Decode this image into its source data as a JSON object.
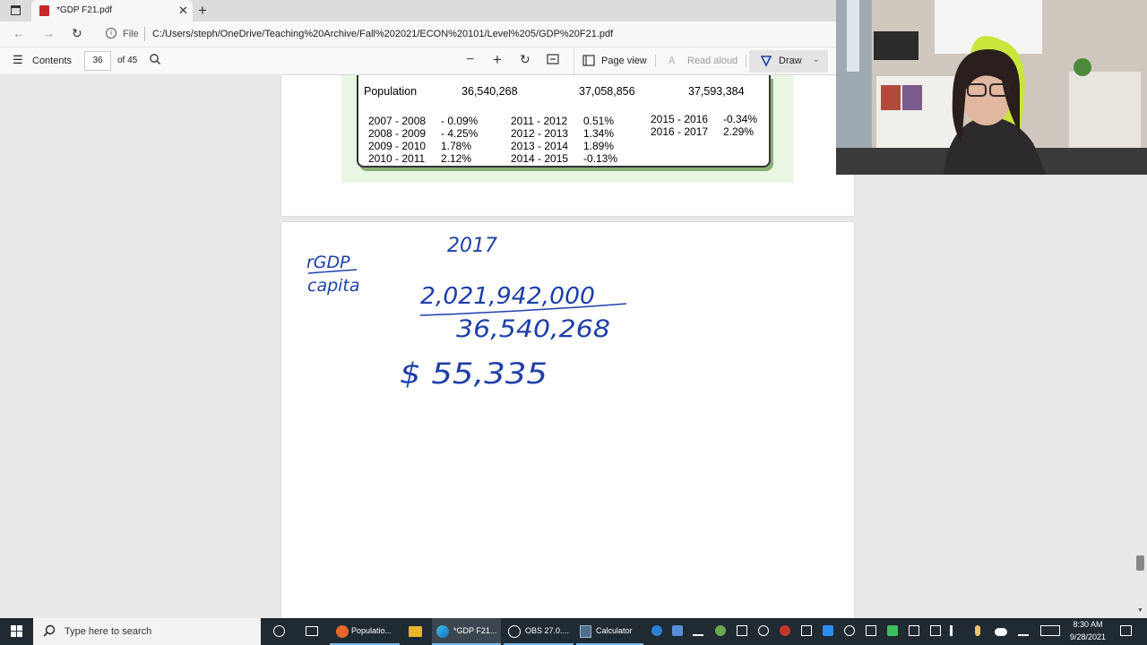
{
  "browser": {
    "tab_title": "*GDP F21.pdf",
    "file_label": "File",
    "url": "C:/Users/steph/OneDrive/Teaching%20Archive/Fall%202021/ECON%20101/Level%205/GDP%20F21.pdf"
  },
  "pdf_toolbar": {
    "contents_label": "Contents",
    "page_current": "36",
    "page_total": "of 45",
    "page_view_label": "Page view",
    "read_aloud_label": "Read aloud",
    "draw_label": "Draw"
  },
  "table": {
    "population_label": "Population",
    "population_values": [
      "36,540,268",
      "37,058,856",
      "37,593,384"
    ],
    "growth_col1": [
      {
        "period": "2007 - 2008",
        "rate": "- 0.09%"
      },
      {
        "period": "2008 - 2009",
        "rate": "- 4.25%"
      },
      {
        "period": "2009 - 2010",
        "rate": "1.78%"
      },
      {
        "period": "2010 - 2011",
        "rate": "2.12%"
      }
    ],
    "growth_col2": [
      {
        "period": "2011 - 2012",
        "rate": "0.51%"
      },
      {
        "period": "2012 - 2013",
        "rate": "1.34%"
      },
      {
        "period": "2013 - 2014",
        "rate": "1.89%"
      },
      {
        "period": "2014 - 2015",
        "rate": "-0.13%"
      }
    ],
    "growth_col3": [
      {
        "period": "2015 - 2016",
        "rate": "-0.34%"
      },
      {
        "period": "2016 - 2017",
        "rate": "2.29%"
      }
    ]
  },
  "handwriting": {
    "numerator_label": "rGDP",
    "denominator_label": "capita",
    "year": "2017",
    "numerator": "2,021,942,000",
    "denominator": "36,540,268",
    "result": "$ 55,335",
    "ink_color": "#1e3fa8"
  },
  "taskbar": {
    "search_placeholder": "Type here to search",
    "apps": [
      "Populatio...",
      "*GDP F21...",
      "OBS 27.0....",
      "Calculator"
    ],
    "time": "8:30 AM",
    "date": "9/28/2021"
  }
}
